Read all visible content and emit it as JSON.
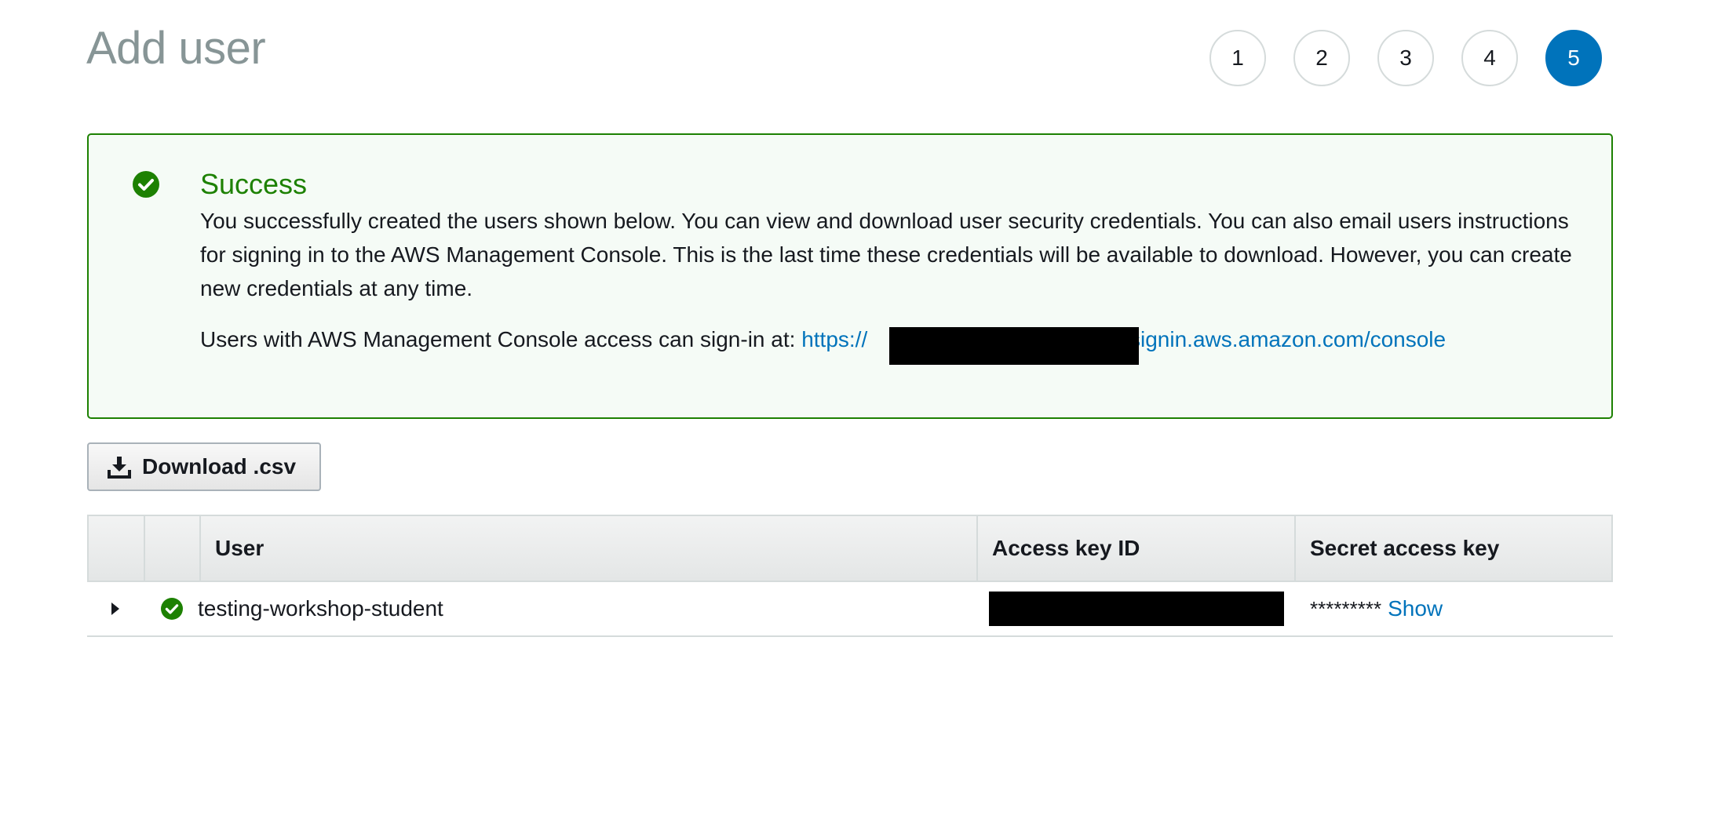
{
  "header": {
    "title": "Add user",
    "steps": [
      "1",
      "2",
      "3",
      "4",
      "5"
    ],
    "active_step": "5"
  },
  "success": {
    "icon": "check-circle-icon",
    "title": "Success",
    "message": "You successfully created the users shown below. You can view and download user security credentials. You can also email users instructions for signing in to the AWS Management Console. This is the last time these credentials will be available to download. However, you can create new credentials at any time.",
    "signin_prefix": "Users with AWS Management Console access can sign-in at: ",
    "signin_url_start": "https://",
    "signin_url_end": ".signin.aws.amazon.com/console"
  },
  "download": {
    "label": "Download .csv",
    "icon": "download-icon"
  },
  "table": {
    "headers": {
      "user": "User",
      "access_key_id": "Access key ID",
      "secret_access_key": "Secret access key"
    },
    "rows": [
      {
        "user": "testing-workshop-student",
        "secret_mask": "*********",
        "show_label": "Show"
      }
    ]
  },
  "colors": {
    "success_green": "#1d8102",
    "link_blue": "#0073bb",
    "active_step": "#0073bb"
  }
}
